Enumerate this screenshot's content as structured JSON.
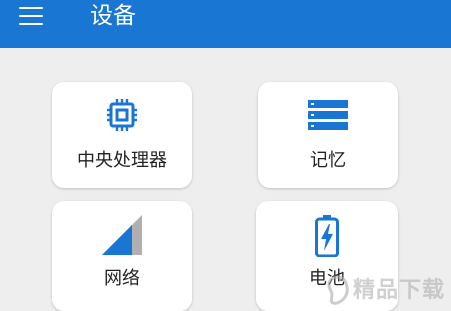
{
  "app_bar": {
    "title": "设备",
    "menu_icon": "hamburger-menu-icon",
    "background": "#1976d2"
  },
  "cards": [
    {
      "label": "中央处理器",
      "icon": "cpu-chip-icon"
    },
    {
      "label": "记忆",
      "icon": "memory-list-icon"
    },
    {
      "label": "网络",
      "icon": "signal-strength-icon"
    },
    {
      "label": "电池",
      "icon": "battery-charging-icon"
    }
  ],
  "colors": {
    "accent": "#1976d2",
    "background": "#eeeeee",
    "card": "#ffffff",
    "icon_gray": "#b0b0b0"
  },
  "watermark": {
    "text": "精品下载"
  }
}
